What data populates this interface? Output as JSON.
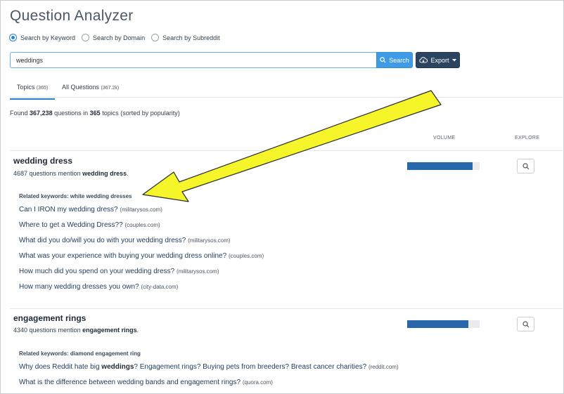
{
  "app": {
    "title": "Question Analyzer"
  },
  "search_modes": [
    {
      "label": "Search by Keyword",
      "checked": true
    },
    {
      "label": "Search by Domain",
      "checked": false
    },
    {
      "label": "Search by Subreddit",
      "checked": false
    }
  ],
  "search": {
    "value": "weddings",
    "button_label": "Search",
    "button_icon": "search-icon"
  },
  "export": {
    "label": "Export",
    "icon": "cloud-download-icon"
  },
  "tabs": [
    {
      "label": "Topics",
      "count": "(365)"
    },
    {
      "label": "All Questions",
      "count": "(367.2k)"
    }
  ],
  "summary": {
    "prefix": "Found",
    "questions": "367,238",
    "middle": "questions in",
    "topics": "365",
    "suffix": "topics (sorted by popularity)"
  },
  "columns": {
    "volume": "VOLUME",
    "explore": "EXPLORE"
  },
  "topics": [
    {
      "name": "wedding dress",
      "mention_count": "4687 questions mention",
      "mention_term": "wedding dress",
      "volume_fraction": 0.9,
      "related": "Related keywords: white wedding dresses",
      "questions": [
        {
          "text": "Can I IRON my wedding dress?",
          "domain": "(militarysos.com)"
        },
        {
          "text": "Where to get a Wedding Dress??",
          "domain": "(couples.com)"
        },
        {
          "text": "What did you do/will you do with your wedding dress?",
          "domain": "(militarysos.com)"
        },
        {
          "text": "What was your experience with buying your wedding dress online?",
          "domain": "(couples.com)"
        },
        {
          "text": "How much did you spend on your wedding dress?",
          "domain": "(militarysos.com)"
        },
        {
          "text": "How many wedding dresses you own?",
          "domain": "(city-data.com)"
        }
      ]
    },
    {
      "name": "engagement rings",
      "mention_count": "4340 questions mention",
      "mention_term": "engagement rings",
      "volume_fraction": 0.84,
      "related": "Related keywords: diamond engagement ring",
      "questions": [
        {
          "before": "Why does Reddit hate big",
          "bold": "weddings",
          "after": "? Engagement rings? Buying pets from breeders? Breast cancer charities?",
          "domain": "(reddit.com)"
        },
        {
          "text": "What is the difference between wedding bands and engagement rings?",
          "domain": "(quora.com)"
        }
      ]
    }
  ],
  "colors": {
    "accent": "#2a83d1",
    "bar": "#2867ab",
    "export_bg": "#2b4561",
    "arrow": "#f5f52a"
  }
}
